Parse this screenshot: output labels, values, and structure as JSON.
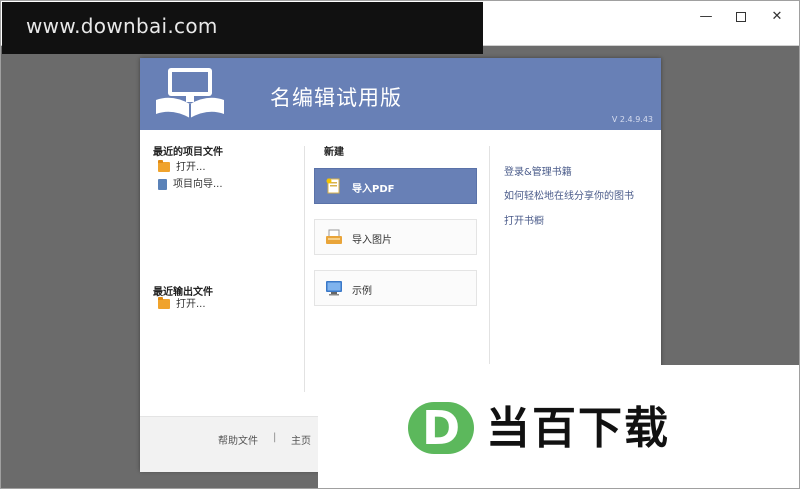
{
  "watermark_top": {
    "text": "www.downbai.com"
  },
  "window_controls": {
    "minimize": "—",
    "close": "✕"
  },
  "dialog": {
    "title": "名编辑试用版",
    "version": "V 2.4.9.43",
    "header_color": "#6880b6"
  },
  "recent_projects": {
    "heading": "最近的项目文件",
    "items": [
      {
        "label": "打开...",
        "icon": "folder-icon"
      },
      {
        "label": "项目向导...",
        "icon": "book-icon"
      }
    ]
  },
  "recent_exports": {
    "heading": "最近输出文件",
    "items": [
      {
        "label": "打开...",
        "icon": "folder-icon"
      }
    ]
  },
  "new_section": {
    "heading": "新建",
    "buttons": [
      {
        "label": "导入PDF",
        "icon": "pdf-import-icon",
        "selected": true
      },
      {
        "label": "导入图片",
        "icon": "image-import-icon",
        "selected": false
      },
      {
        "label": "示例",
        "icon": "monitor-icon",
        "selected": false
      }
    ]
  },
  "right_links": [
    "登录&管理书籍",
    "如何轻松地在线分享你的图书",
    "打开书橱"
  ],
  "footer": {
    "help": "帮助文件",
    "separator": "|",
    "home": "主页"
  },
  "watermark_bottom": {
    "logo_letter": "D",
    "text": "当百下载",
    "accent": "#5cb85c"
  }
}
